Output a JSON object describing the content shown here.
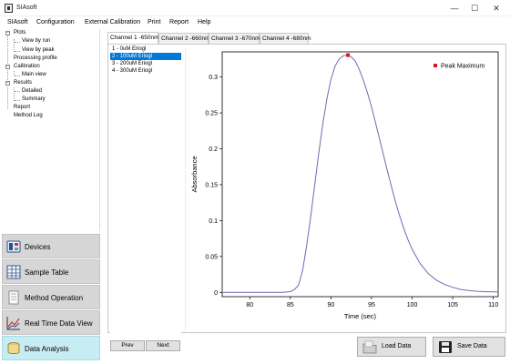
{
  "window": {
    "title": "SIAsoft",
    "minimize_glyph": "—",
    "maximize_glyph": "☐",
    "close_glyph": "✕"
  },
  "menu": [
    "SIAsoft",
    "Configuration",
    "External Calibration",
    "Print",
    "Report",
    "Help"
  ],
  "tree": {
    "plots": "Plots",
    "view_by_run": "View by run",
    "view_by_peak": "View by peak",
    "processing_profile": "Processing profile",
    "calibration": "Calibration",
    "main_view": "Main view",
    "results": "Results",
    "detailed": "Detailed",
    "summary": "Summary",
    "report": "Report",
    "method_log": "Method Log",
    "collapse_glyph": "−"
  },
  "nav": {
    "devices": "Devices",
    "sample_table": "Sample Table",
    "method_operation": "Method Operation",
    "real_time": "Real Time Data View",
    "data_analysis": "Data Analysis"
  },
  "tabs": [
    "Channel 1 -650nm",
    "Channel 2 -660nm",
    "Channel 3 -670nm",
    "Channel 4 -680nm"
  ],
  "samples": [
    "1 - 0uM Eriogl",
    "2 - 100uM Eriogl",
    "3 - 200uM Eriogl",
    "4 - 300uM Eriogl"
  ],
  "selected_sample_index": 1,
  "buttons": {
    "prev": "Prev",
    "next": "Next",
    "load_data": "Load Data",
    "save_data": "Save Data"
  },
  "colors": {
    "curve": "#6b6bb5",
    "peak_marker": "#d11a1a",
    "selection": "#0078d7",
    "active_nav": "#c8ecf3"
  },
  "chart_data": {
    "type": "line",
    "title": "",
    "xlabel": "Time (sec)",
    "ylabel": "Absorbance",
    "xlim": [
      76.6,
      110.6
    ],
    "ylim": [
      -0.006,
      0.335
    ],
    "xticks": [
      80,
      85,
      90,
      95,
      100,
      105,
      110
    ],
    "yticks": [
      0,
      0.05,
      0.1,
      0.15,
      0.2,
      0.25,
      0.3
    ],
    "grid": false,
    "legend": {
      "placement": "top-right",
      "entries": [
        "Peak Maximum"
      ]
    },
    "peak": {
      "x": 92.1,
      "y": 0.3305,
      "label": "Peak Maximum"
    },
    "series": [
      {
        "x": [
          76.6,
          80,
          84,
          85,
          85.5,
          86,
          86.5,
          87,
          87.5,
          88,
          88.5,
          89,
          89.5,
          90,
          90.5,
          91,
          91.5,
          92,
          92.5,
          93,
          93.5,
          94,
          94.5,
          95,
          95.5,
          96,
          96.5,
          97,
          97.5,
          98,
          98.5,
          99,
          99.5,
          100,
          101,
          102,
          103,
          104,
          105,
          106,
          107,
          108,
          109,
          110.6
        ],
        "y": [
          0,
          0,
          0,
          0.001,
          0.004,
          0.01,
          0.03,
          0.065,
          0.105,
          0.15,
          0.195,
          0.235,
          0.27,
          0.297,
          0.315,
          0.325,
          0.3295,
          0.3305,
          0.328,
          0.322,
          0.31,
          0.295,
          0.278,
          0.258,
          0.236,
          0.213,
          0.19,
          0.167,
          0.145,
          0.124,
          0.105,
          0.088,
          0.073,
          0.06,
          0.04,
          0.026,
          0.017,
          0.011,
          0.007,
          0.004,
          0.0025,
          0.0015,
          0.001,
          0.0005
        ]
      }
    ]
  }
}
